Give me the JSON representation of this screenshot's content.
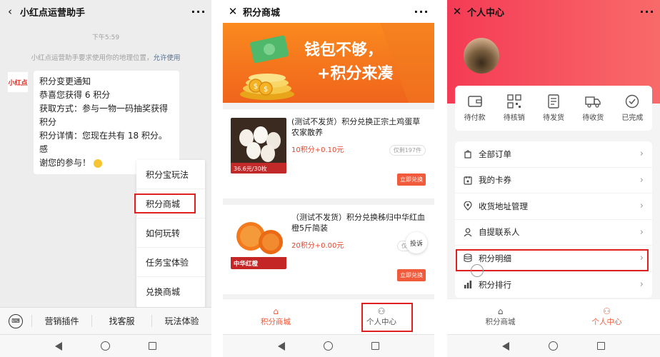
{
  "panel1": {
    "header": {
      "back_icon": "chevron-left",
      "title": "小红点运营助手",
      "more": "···"
    },
    "time": "下午5:59",
    "system_message": "小红点运营助手要求使用你的地理位置，",
    "system_link": "允许使用",
    "avatar_text": "小红点",
    "bubble": {
      "line1": "积分变更通知",
      "line2": "恭喜您获得 6 积分",
      "line3": "获取方式：参与一物一码抽奖获得",
      "line4": "积分",
      "line5": "积分详情：您现在共有 18 积分。感",
      "line6": "谢您的参与！"
    },
    "popup_menu": [
      "积分宝玩法",
      "积分商城",
      "如何玩转",
      "任务宝体验",
      "兑换商城"
    ],
    "bottom_menu": [
      "营销插件",
      "找客服",
      "玩法体验"
    ],
    "keyboard_icon": "keyboard-icon"
  },
  "panel2": {
    "header": {
      "close": "✕",
      "title": "积分商城",
      "more": "···"
    },
    "banner": {
      "line1": "钱包不够，",
      "line2": "+积分来凑"
    },
    "products": [
      {
        "title": "(测试不发货）积分兑换正宗土鸡蛋草农家散养",
        "price": "10积分+0.10元",
        "stock": "仅剩197件",
        "button": "立即兑换",
        "img_label": "36.6元/30枚"
      },
      {
        "title": "（测试不发货）积分兑换秭归中华红血橙5斤简装",
        "price": "20积分+0.00元",
        "stock": "仅",
        "button": "立即兑换",
        "img_label": "中华红橙"
      }
    ],
    "complain": "投诉",
    "tabs": [
      {
        "label": "积分商城",
        "icon": "home-icon",
        "active": true
      },
      {
        "label": "个人中心",
        "icon": "user-icon",
        "active": false
      }
    ]
  },
  "panel3": {
    "header": {
      "close": "✕",
      "title": "个人中心",
      "more": "···"
    },
    "orders": [
      "待付款",
      "待核销",
      "待发货",
      "待收货",
      "已完成"
    ],
    "menu": [
      "全部订单",
      "我的卡券",
      "收货地址管理",
      "自提联系人",
      "积分明细",
      "积分排行"
    ],
    "tabs": [
      {
        "label": "积分商城",
        "icon": "home-icon",
        "active": false
      },
      {
        "label": "个人中心",
        "icon": "user-icon",
        "active": true
      }
    ]
  },
  "colors": {
    "accent_red": "#f15a3a",
    "highlight": "#e02020",
    "banner_orange": "#fa8a1e",
    "header_red": "#f53b55"
  }
}
